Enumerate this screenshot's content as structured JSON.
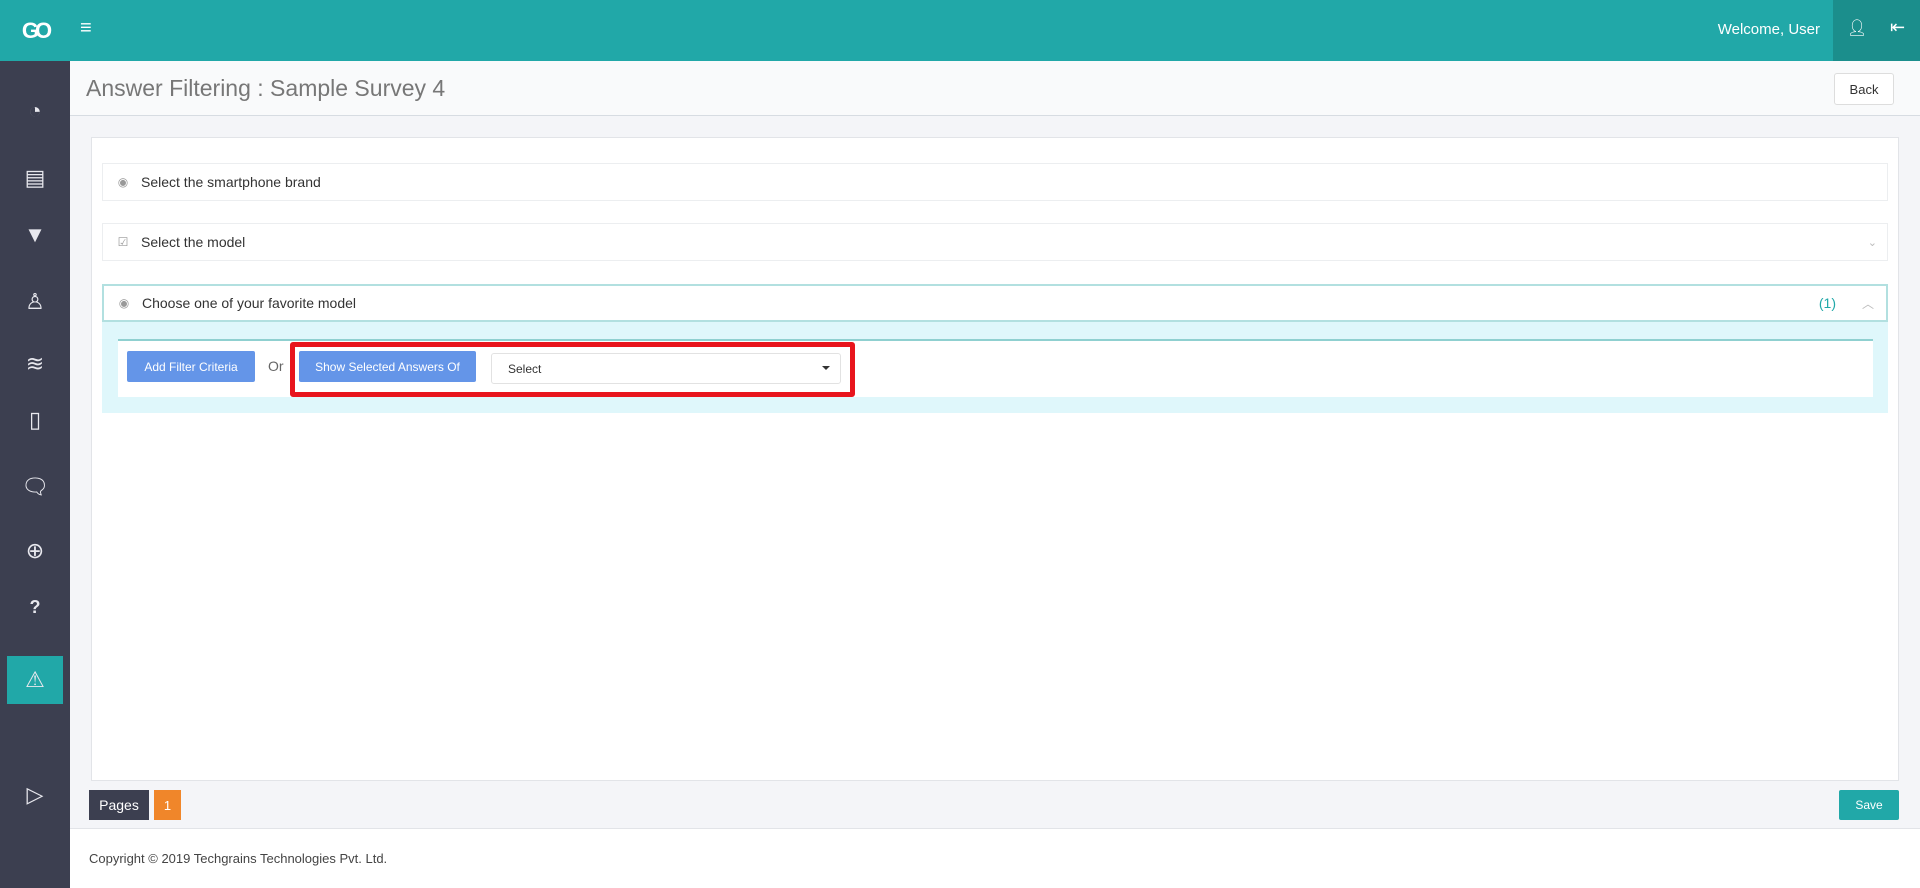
{
  "header": {
    "logo": "GO",
    "welcome": "Welcome, User"
  },
  "sidebar": {
    "items": [
      {
        "icon": "dashboard-icon",
        "glyph": "◔"
      },
      {
        "icon": "book-icon",
        "glyph": "▤"
      },
      {
        "icon": "filter-icon",
        "glyph": "▼"
      },
      {
        "icon": "user-icon",
        "glyph": "♙"
      },
      {
        "icon": "layers-icon",
        "glyph": "≋"
      },
      {
        "icon": "tablet-icon",
        "glyph": "▯"
      },
      {
        "icon": "chat-icon",
        "glyph": "🗨"
      },
      {
        "icon": "support-icon",
        "glyph": "⊕"
      },
      {
        "icon": "help-icon",
        "glyph": "?"
      },
      {
        "icon": "warning-icon",
        "glyph": "⚠",
        "active": true
      },
      {
        "icon": "apple-icon",
        "glyph": ""
      },
      {
        "icon": "play-store-icon",
        "glyph": "▷"
      }
    ]
  },
  "page": {
    "title": "Answer Filtering : Sample Survey 4",
    "back": "Back"
  },
  "questions": [
    {
      "text": "Select the smartphone brand",
      "type": "radio"
    },
    {
      "text": "Select the model",
      "type": "checkbox"
    },
    {
      "text": "Choose one of your favorite model",
      "type": "radio",
      "count": "(1)",
      "expanded": true
    }
  ],
  "filter": {
    "add_filter": "Add Filter Criteria",
    "or": "Or",
    "show_selected": "Show Selected Answers Of",
    "select_value": "Select"
  },
  "pagination": {
    "label": "Pages",
    "current": "1"
  },
  "save": "Save",
  "footer": {
    "copyright": "Copyright © 2019 Techgrains Technologies Pvt. Ltd."
  },
  "colors": {
    "brand": "#21a8a8",
    "sidebar": "#3c3f50",
    "button": "#6495e8",
    "page_active": "#f0862a",
    "highlight": "#e8151d"
  }
}
